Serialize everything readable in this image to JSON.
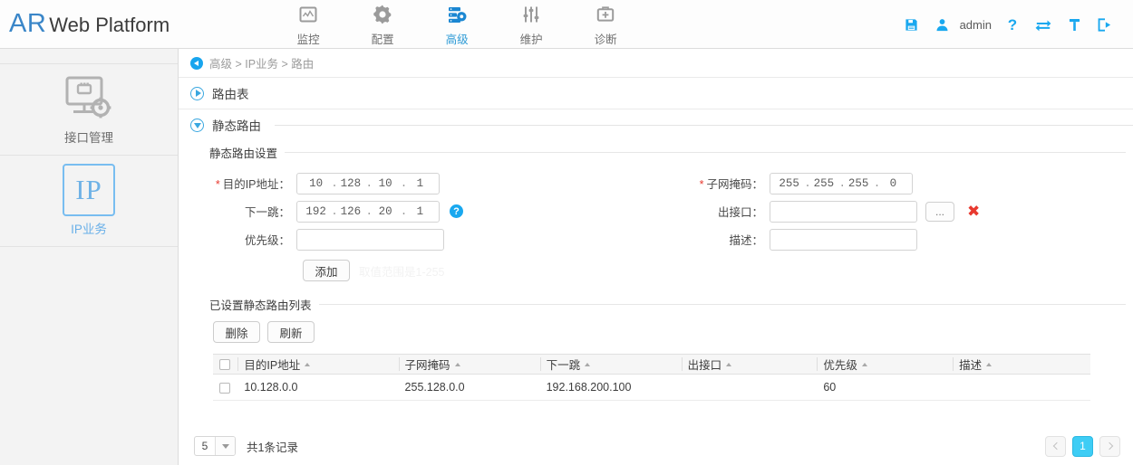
{
  "header": {
    "brand_short": "AR",
    "brand_name": "Web Platform",
    "nav": [
      {
        "label": "监控",
        "icon": "monitor-chart-icon",
        "active": false
      },
      {
        "label": "配置",
        "icon": "gear-icon",
        "active": false
      },
      {
        "label": "高级",
        "icon": "server-gear-icon",
        "active": true
      },
      {
        "label": "维护",
        "icon": "sliders-icon",
        "active": false
      },
      {
        "label": "诊断",
        "icon": "medical-kit-icon",
        "active": false
      }
    ],
    "right": {
      "save_icon": "save-disk-icon",
      "user_icon": "user-icon",
      "username": "admin",
      "help_icon": "question-mark-icon",
      "switch_icon": "swap-arrows-icon",
      "tool_icon": "screwdriver-icon",
      "logout_icon": "logout-icon"
    },
    "accent_blue": "#2e9bd6",
    "accent_cyan": "#19a8ef"
  },
  "sidebar": {
    "items": [
      {
        "label": "接口管理",
        "icon": "monitor-gear-icon",
        "active": false
      },
      {
        "label": "IP业务",
        "icon": "ip-box-icon",
        "icon_text": "IP",
        "active": true
      }
    ]
  },
  "breadcrumb": {
    "back_icon": "back-arrow-icon",
    "path": "高级 > IP业务 > 路由"
  },
  "sections": [
    {
      "title": "路由表",
      "state": "collapsed"
    },
    {
      "title": "静态路由",
      "state": "expanded"
    }
  ],
  "static_route_settings": {
    "title": "静态路由设置",
    "fields": {
      "dest_ip": {
        "label": "目的IP地址：",
        "required": true,
        "segments": [
          "10",
          "128",
          "10",
          "1"
        ]
      },
      "subnet_mask": {
        "label": "子网掩码：",
        "required": true,
        "segments": [
          "255",
          "255",
          "255",
          "0"
        ]
      },
      "next_hop": {
        "label": "下一跳：",
        "required": false,
        "segments": [
          "192",
          "126",
          "20",
          "1"
        ],
        "help_icon": "question-circle-icon"
      },
      "out_interface": {
        "label": "出接口：",
        "required": false,
        "value": "",
        "placeholder": "",
        "browse_label": "...",
        "clear_icon": "red-x-icon"
      },
      "priority": {
        "label": "优先级：",
        "required": false,
        "value": "",
        "placeholder": ""
      },
      "description": {
        "label": "描述：",
        "required": false,
        "value": "",
        "placeholder": ""
      }
    },
    "add_button": "添加",
    "fading_tip": "取值范围是1-255"
  },
  "route_list": {
    "title": "已设置静态路由列表",
    "buttons": {
      "delete": "删除",
      "refresh": "刷新"
    },
    "columns": [
      {
        "label": "目的IP地址",
        "sortable": true
      },
      {
        "label": "子网掩码",
        "sortable": true
      },
      {
        "label": "下一跳",
        "sortable": true
      },
      {
        "label": "出接口",
        "sortable": true
      },
      {
        "label": "优先级",
        "sortable": true
      },
      {
        "label": "描述",
        "sortable": true
      }
    ],
    "rows": [
      {
        "dest_ip": "10.128.0.0",
        "subnet_mask": "255.128.0.0",
        "next_hop": "192.168.200.100",
        "out_interface": "",
        "priority": "60",
        "description": ""
      }
    ]
  },
  "pager": {
    "page_size": "5",
    "total_text": "共1条记录",
    "prev_icon": "chevron-left-icon",
    "next_icon": "chevron-right-icon",
    "pages": [
      "1"
    ],
    "current_page": "1"
  }
}
